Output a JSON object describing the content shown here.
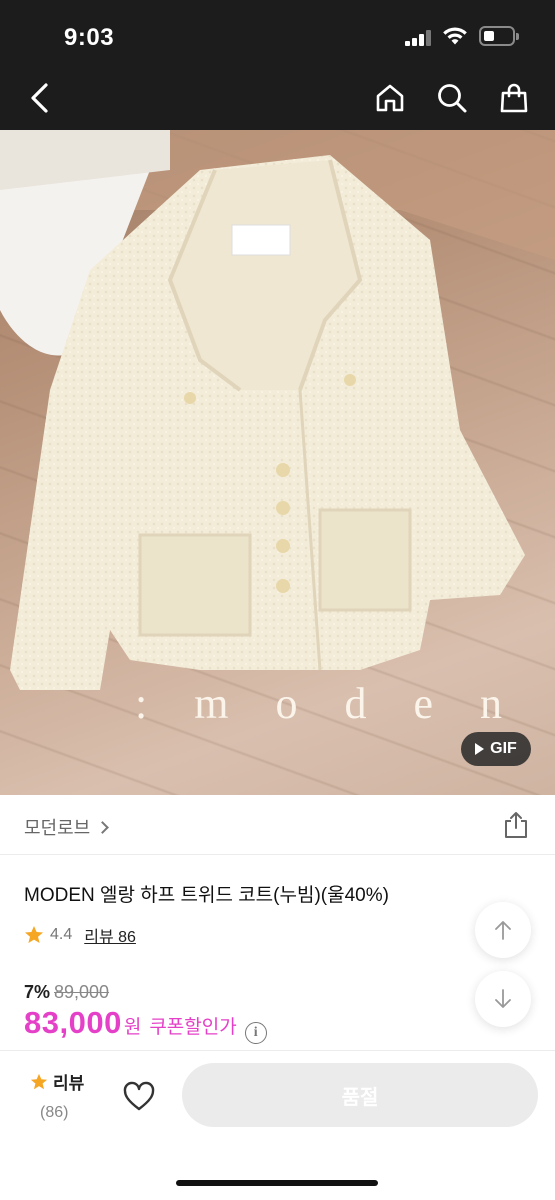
{
  "status_bar": {
    "time": "9:03"
  },
  "nav": {
    "back_icon": "chevron-left-icon",
    "home_icon": "home-icon",
    "search_icon": "search-icon",
    "bag_icon": "shopping-bag-icon"
  },
  "hero": {
    "watermark": ": m o d e n",
    "gif_badge": "GIF"
  },
  "brand": {
    "name": "모던로브"
  },
  "product": {
    "name": "MODEN 엘랑 하프 트위드 코트(누빔)(울40%)",
    "rating": "4.4",
    "review_label": "리뷰 86",
    "discount_rate": "7%",
    "original_price": "89,000",
    "price": "83,000",
    "currency": "원",
    "coupon_text": "쿠폰할인가",
    "info_icon": "i"
  },
  "bottom_bar": {
    "review_label": "리뷰",
    "review_count": "(86)",
    "soldout_label": "품절"
  },
  "colors": {
    "accent": "#e541c8",
    "star": "#f5a623",
    "header_bg": "#1c1c1c"
  }
}
